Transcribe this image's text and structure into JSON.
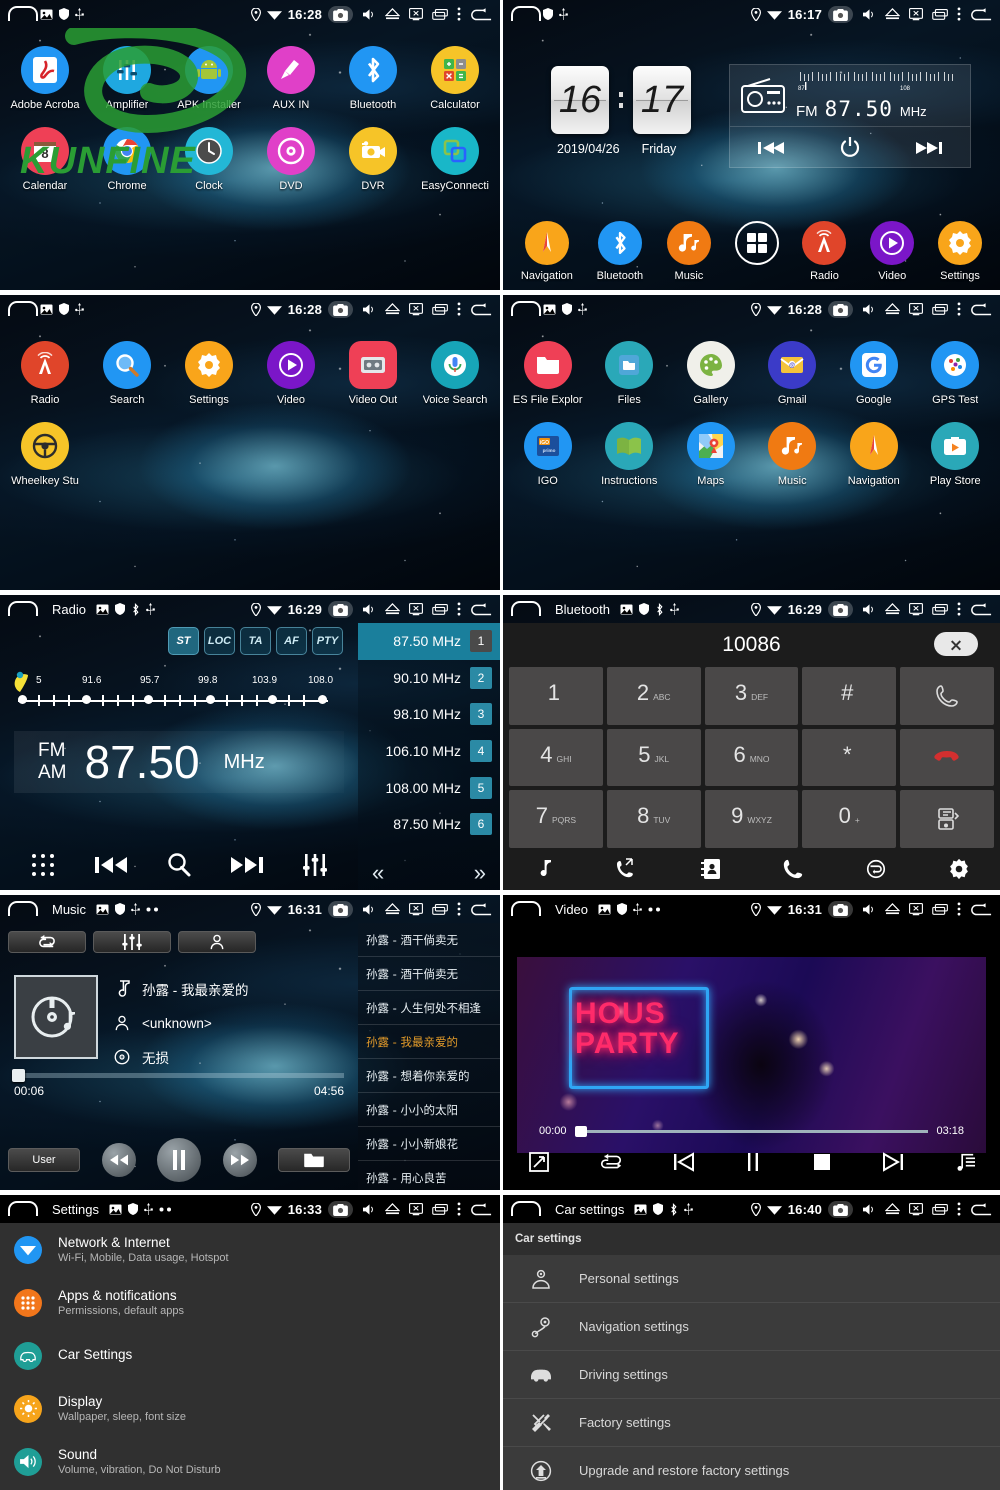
{
  "statusbar": {
    "icons": [
      "location-icon",
      "wifi-icon",
      "camera-icon",
      "volume-icon",
      "eject-icon",
      "screenshot-icon",
      "recents-icon",
      "overflow-icon",
      "back-icon"
    ],
    "p1_time": "16:28",
    "p2_time": "16:17",
    "p3_time": "16:28",
    "p4_time": "16:28",
    "p5_time": "16:29",
    "p6_time": "16:29",
    "p7_time": "16:31",
    "p8_time": "16:31",
    "p9_time": "16:33",
    "p10_time": "16:40",
    "p5_title": "Radio",
    "p6_title": "Bluetooth",
    "p7_title": "Music",
    "p8_title": "Video",
    "p9_title": "Settings",
    "p10_title": "Car settings"
  },
  "panel1": {
    "watermark_text": "KUNFINE",
    "apps": [
      {
        "label": "Adobe Acroba",
        "icon": "adobe-acrobat-icon",
        "color": "#2196f3"
      },
      {
        "label": "Amplifier",
        "icon": "amplifier-icon",
        "color": "#1fa8e0"
      },
      {
        "label": "APK Installer",
        "icon": "apk-installer-icon",
        "color": "#2196f3"
      },
      {
        "label": "AUX IN",
        "icon": "aux-in-icon",
        "color": "#e040c8"
      },
      {
        "label": "Bluetooth",
        "icon": "bluetooth-icon",
        "color": "#2196f3"
      },
      {
        "label": "Calculator",
        "icon": "calculator-icon",
        "color": "#f6c428"
      },
      {
        "label": "Calendar",
        "icon": "calendar-icon",
        "color": "#ef4056"
      },
      {
        "label": "Chrome",
        "icon": "chrome-icon",
        "color": "#2196f3"
      },
      {
        "label": "Clock",
        "icon": "clock-icon",
        "color": "#23b7d6"
      },
      {
        "label": "DVD",
        "icon": "dvd-icon",
        "color": "#e040c8"
      },
      {
        "label": "DVR",
        "icon": "dvr-icon",
        "color": "#f6c428"
      },
      {
        "label": "EasyConnecti",
        "icon": "easyconnection-icon",
        "color": "#19b7c8"
      }
    ]
  },
  "panel2": {
    "clock": {
      "hour": "16",
      "minute": "17",
      "date": "2019/04/26",
      "weekday": "Friday"
    },
    "radio_widget": {
      "band": "FM",
      "frequency": "87.50",
      "unit": "MHz",
      "scale_min": "87",
      "scale_max": "108",
      "buttons": [
        "prev-icon",
        "power-icon",
        "next-icon"
      ]
    },
    "dock": [
      {
        "label": "Navigation",
        "icon": "compass-icon",
        "color": "#f9a51a"
      },
      {
        "label": "Bluetooth",
        "icon": "bluetooth-icon",
        "color": "#2196f3"
      },
      {
        "label": "Music",
        "icon": "music-note-icon",
        "color": "#f07a12"
      },
      {
        "label": "",
        "icon": "apps-grid-icon",
        "color": "transparent"
      },
      {
        "label": "Radio",
        "icon": "radio-tower-icon",
        "color": "#e0452a"
      },
      {
        "label": "Video",
        "icon": "video-play-icon",
        "color": "#7b16c8"
      },
      {
        "label": "Settings",
        "icon": "gear-icon",
        "color": "#f9a51a"
      }
    ]
  },
  "panel3": {
    "apps": [
      {
        "label": "Radio",
        "icon": "radio-tower-icon",
        "color": "#e0452a"
      },
      {
        "label": "Search",
        "icon": "magnifier-icon",
        "color": "#2196f3"
      },
      {
        "label": "Settings",
        "icon": "gear-icon",
        "color": "#f9a51a"
      },
      {
        "label": "Video",
        "icon": "video-play-icon",
        "color": "#7b16c8"
      },
      {
        "label": "Video Out",
        "icon": "video-out-icon",
        "color": "#ef4056"
      },
      {
        "label": "Voice Search",
        "icon": "microphone-icon",
        "color": "#17a5b8"
      },
      {
        "label": "Wheelkey Stu",
        "icon": "steering-wheel-icon",
        "color": "#f6c428"
      }
    ]
  },
  "panel4": {
    "apps": [
      {
        "label": "ES File Explor",
        "icon": "es-file-explorer-icon",
        "color": "#ef4056"
      },
      {
        "label": "Files",
        "icon": "files-folder-icon",
        "color": "#2aa8b8"
      },
      {
        "label": "Gallery",
        "icon": "gallery-palette-icon",
        "color": "#f0f0ea"
      },
      {
        "label": "Gmail",
        "icon": "gmail-envelope-icon",
        "color": "#3b3bc8"
      },
      {
        "label": "Google",
        "icon": "google-g-icon",
        "color": "#2196f3"
      },
      {
        "label": "GPS Test",
        "icon": "gps-test-icon",
        "color": "#2196f3"
      },
      {
        "label": "IGO",
        "icon": "igo-icon",
        "color": "#2196f3"
      },
      {
        "label": "Instructions",
        "icon": "instructions-book-icon",
        "color": "#2aa8b8"
      },
      {
        "label": "Maps",
        "icon": "maps-pin-icon",
        "color": "#2196f3"
      },
      {
        "label": "Music",
        "icon": "music-note-icon",
        "color": "#f07a12"
      },
      {
        "label": "Navigation",
        "icon": "compass-icon",
        "color": "#f9a51a"
      },
      {
        "label": "Play Store",
        "icon": "play-store-icon",
        "color": "#2aa8b8"
      }
    ]
  },
  "panel5_radio": {
    "band_buttons": [
      {
        "label": "ST",
        "active": true
      },
      {
        "label": "LOC",
        "active": false
      },
      {
        "label": "TA",
        "active": false
      },
      {
        "label": "AF",
        "active": false
      },
      {
        "label": "PTY",
        "active": false
      }
    ],
    "scale_labels": [
      "5",
      "91.6",
      "95.7",
      "99.8",
      "103.9",
      "108.0"
    ],
    "band_fm": "FM",
    "band_am": "AM",
    "frequency": "87.50",
    "unit": "MHz",
    "controls": [
      "apps-grid-icon",
      "prev-track-icon",
      "scan-search-icon",
      "next-track-icon",
      "equalizer-icon"
    ],
    "presets": [
      {
        "freq": "87.50 MHz",
        "num": "1",
        "selected": true
      },
      {
        "freq": "90.10 MHz",
        "num": "2",
        "selected": false
      },
      {
        "freq": "98.10 MHz",
        "num": "3",
        "selected": false
      },
      {
        "freq": "106.10 MHz",
        "num": "4",
        "selected": false
      },
      {
        "freq": "108.00 MHz",
        "num": "5",
        "selected": false
      },
      {
        "freq": "87.50 MHz",
        "num": "6",
        "selected": false
      }
    ],
    "page_prev": "«",
    "page_next": "»"
  },
  "panel6_bluetooth": {
    "dialed_number": "10086",
    "keys": [
      {
        "digit": "1",
        "sub": ""
      },
      {
        "digit": "2",
        "sub": "ABC"
      },
      {
        "digit": "3",
        "sub": "DEF"
      },
      {
        "digit": "#",
        "sub": ""
      },
      {
        "digit": "",
        "sub": "",
        "icon": "call-icon"
      },
      {
        "digit": "4",
        "sub": "GHI"
      },
      {
        "digit": "5",
        "sub": "JKL"
      },
      {
        "digit": "6",
        "sub": "MNO"
      },
      {
        "digit": "*",
        "sub": ""
      },
      {
        "digit": "",
        "sub": "",
        "icon": "hangup-icon"
      },
      {
        "digit": "7",
        "sub": "PQRS"
      },
      {
        "digit": "8",
        "sub": "TUV"
      },
      {
        "digit": "9",
        "sub": "WXYZ"
      },
      {
        "digit": "0",
        "sub": "+"
      },
      {
        "digit": "",
        "sub": "",
        "icon": "transfer-icon"
      }
    ],
    "bottombar": [
      "bt-music-icon",
      "call-log-icon",
      "contacts-icon",
      "dialpad-phone-icon",
      "sync-icon",
      "gear-icon"
    ],
    "delete_icon": "backspace-icon"
  },
  "panel7_music": {
    "tabs": [
      "repeat-icon",
      "equalizer-icon",
      "artist-icon"
    ],
    "track_title": "孙露 - 我最亲爱的",
    "artist": "<unknown>",
    "quality": "无损",
    "elapsed": "00:06",
    "duration": "04:56",
    "eq_button": "User",
    "folder_icon": "folder-icon",
    "controls": [
      "rewind-icon",
      "pause-icon",
      "forward-icon"
    ],
    "playlist": [
      "孙露 - 酒干倘卖无",
      "孙露 - 酒干倘卖无",
      "孙露 - 人生何处不相逢",
      "孙露 - 我最亲爱的",
      "孙露 - 想着你亲爱的",
      "孙露 - 小小的太阳",
      "孙露 - 小小新娘花",
      "孙露 - 用心良苦"
    ],
    "playlist_current_index": 3
  },
  "panel8_video": {
    "overlay_text_line1": "HOUS",
    "overlay_text_line2": "PARTY",
    "elapsed": "00:00",
    "duration": "03:18",
    "controls": [
      "fullscreen-icon",
      "repeat-icon",
      "prev-track-icon",
      "pause-icon",
      "stop-icon",
      "next-track-icon",
      "playlist-icon"
    ]
  },
  "panel9_settings": {
    "items": [
      {
        "title": "Network & Internet",
        "sub": "Wi-Fi, Mobile, Data usage, Hotspot",
        "icon": "wifi-icon",
        "color": "#2196f3"
      },
      {
        "title": "Apps & notifications",
        "sub": "Permissions, default apps",
        "icon": "apps-dots-icon",
        "color": "#f2761b"
      },
      {
        "title": "Car Settings",
        "sub": "",
        "icon": "car-icon",
        "color": "#1f9e96"
      },
      {
        "title": "Display",
        "sub": "Wallpaper, sleep, font size",
        "icon": "brightness-icon",
        "color": "#f6a41b"
      },
      {
        "title": "Sound",
        "sub": "Volume, vibration, Do Not Disturb",
        "icon": "speaker-icon",
        "color": "#1f9e96"
      }
    ]
  },
  "panel10_carsettings": {
    "section_header": "Car settings",
    "items": [
      {
        "title": "Personal settings",
        "icon": "person-settings-icon"
      },
      {
        "title": "Navigation settings",
        "icon": "route-pin-icon"
      },
      {
        "title": "Driving settings",
        "icon": "car-icon"
      },
      {
        "title": "Factory settings",
        "icon": "tools-icon"
      },
      {
        "title": "Upgrade and restore factory settings",
        "icon": "upgrade-icon"
      }
    ]
  }
}
